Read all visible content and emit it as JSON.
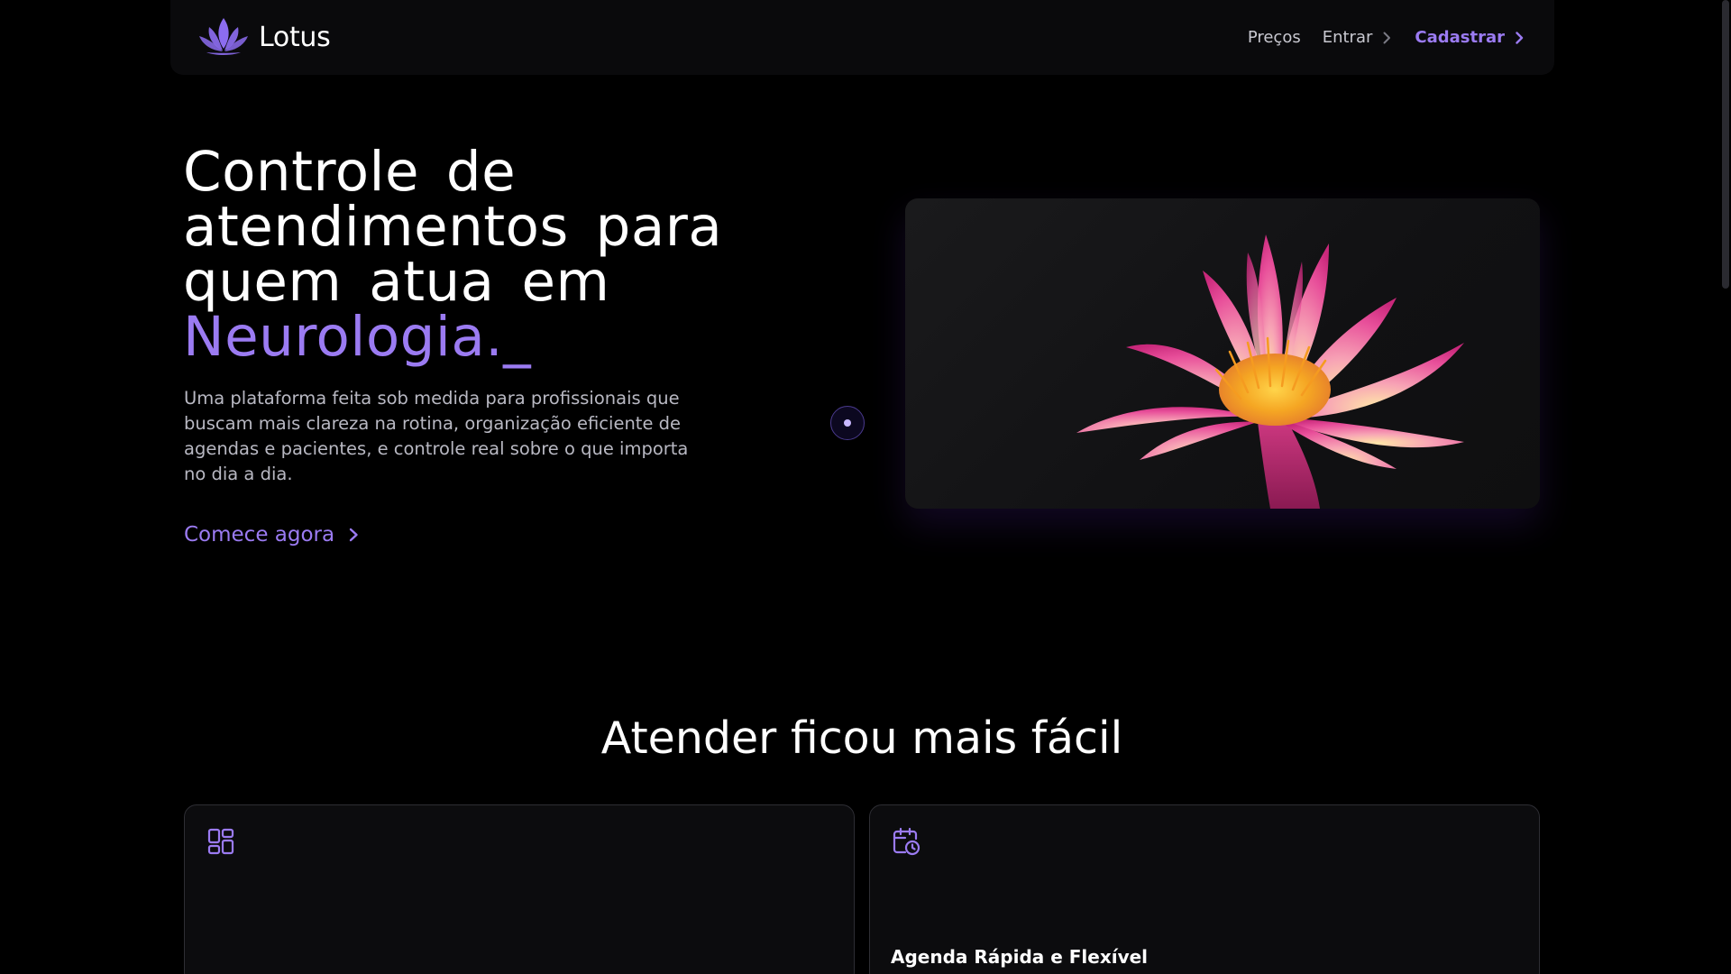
{
  "navbar": {
    "brand": "Lotus",
    "links": {
      "pricing": "Preços",
      "login": "Entrar",
      "signup": "Cadastrar"
    }
  },
  "hero": {
    "title_line1": "Controle de",
    "title_line2": "atendimentos para",
    "title_line3": "quem atua em",
    "title_highlight": "Neurologia.",
    "title_cursor": "_",
    "description": "Uma plataforma feita sob medida para profissionais que buscam mais clareza na rotina, organização eficiente de agendas e pacientes, e controle real sobre o que importa no dia a dia.",
    "cta": "Comece agora"
  },
  "features": {
    "title": "Atender ficou mais fácil",
    "cards": [
      {
        "icon": "dashboard-icon",
        "title": ""
      },
      {
        "icon": "calendar-clock-icon",
        "title": "Agenda Rápida e Flexível"
      }
    ]
  },
  "colors": {
    "accent": "#9b7bf2",
    "background": "#000000",
    "navbar_bg": "#0a0a0c",
    "card_bg": "#0c0c0e",
    "card_border": "#2e2e34"
  }
}
